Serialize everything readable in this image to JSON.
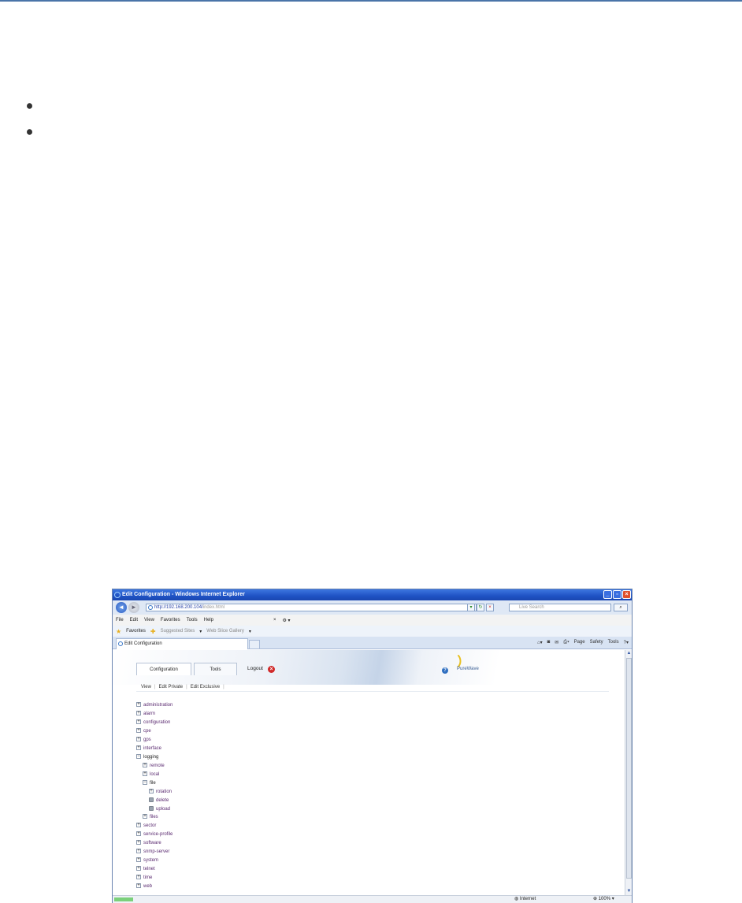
{
  "ie": {
    "window_title": "Edit Configuration - Windows Internet Explorer",
    "url_host": "http://192.168.200.104/",
    "url_path": "index.html",
    "search_placeholder": "Live Search",
    "menu": [
      "File",
      "Edit",
      "View",
      "Favorites",
      "Tools",
      "Help"
    ],
    "favorites": {
      "label": "Favorites",
      "suggested": "Suggested Sites",
      "gallery": "Web Slice Gallery"
    },
    "tab_title": "Edit Configuration",
    "command_bar": [
      "Page",
      "Safety",
      "Tools"
    ],
    "status": {
      "zone": "Internet",
      "zoom": "100%"
    }
  },
  "app": {
    "tabs": [
      "Configuration",
      "Tools"
    ],
    "logout_label": "Logout",
    "logo_text": "PureWave",
    "subnav": [
      "View",
      "Edit Private",
      "Edit Exclusive"
    ],
    "tree": [
      {
        "label": "administration",
        "expander": "+"
      },
      {
        "label": "alarm",
        "expander": "+"
      },
      {
        "label": "configuration",
        "expander": "+"
      },
      {
        "label": "cpe",
        "expander": "+"
      },
      {
        "label": "gps",
        "expander": "+"
      },
      {
        "label": "interface",
        "expander": "+"
      },
      {
        "label": "logging",
        "expander": "−"
      },
      {
        "label": "remote",
        "expander": "+"
      },
      {
        "label": "local",
        "expander": "+"
      },
      {
        "label": "file",
        "expander": "−"
      },
      {
        "label": "rotation",
        "expander": "+"
      },
      {
        "label": "delete",
        "expander": "leaf"
      },
      {
        "label": "upload",
        "expander": "leaf"
      },
      {
        "label": "files",
        "expander": "+"
      },
      {
        "label": "sector",
        "expander": "+"
      },
      {
        "label": "service-profile",
        "expander": "+"
      },
      {
        "label": "software",
        "expander": "+"
      },
      {
        "label": "snmp-server",
        "expander": "+"
      },
      {
        "label": "system",
        "expander": "+"
      },
      {
        "label": "telnet",
        "expander": "+"
      },
      {
        "label": "time",
        "expander": "+"
      },
      {
        "label": "web",
        "expander": "+"
      }
    ]
  }
}
